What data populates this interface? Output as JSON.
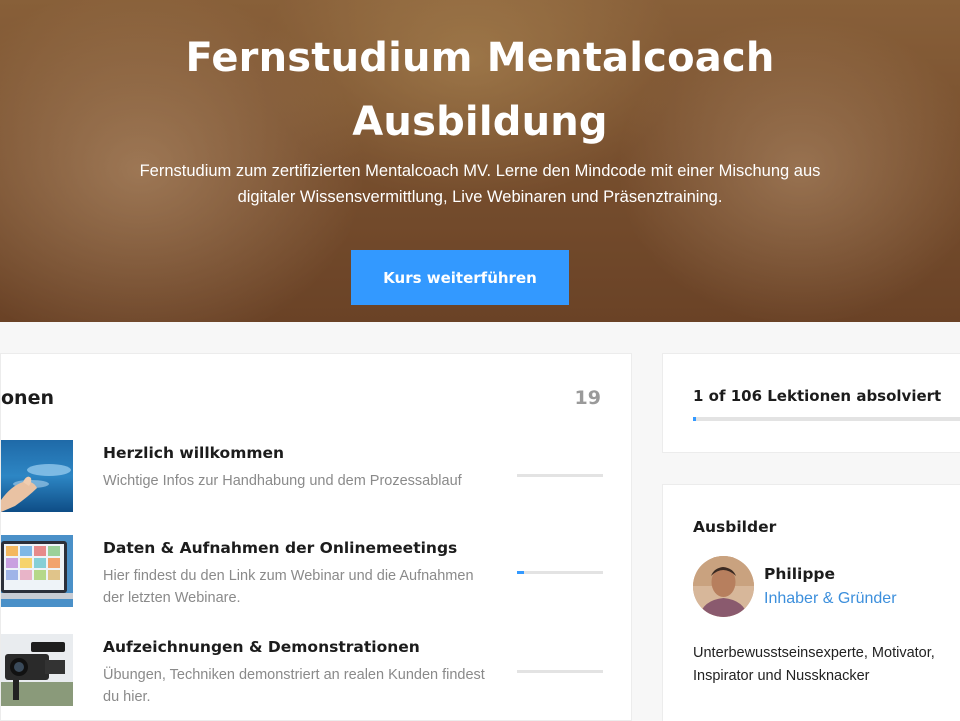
{
  "hero": {
    "title_line1": "Fernstudium Mentalcoach",
    "title_line2": "Ausbildung",
    "subtitle_line1": "Fernstudium zum zertifizierten Mentalcoach MV. Lerne den Mindcode mit einer Mischung aus",
    "subtitle_line2": "digitaler Wissensvermittlung, Live Webinaren und Präsenztraining.",
    "button_label": "Kurs weiterführen"
  },
  "lessons_panel": {
    "title": "onen",
    "count": "19",
    "items": [
      {
        "name": "Herzlich willkommen",
        "description": "Wichtige Infos zur Handhabung und dem Prozessablauf",
        "progress": 0
      },
      {
        "name": "Daten & Aufnahmen der Onlinemeetings",
        "description": "Hier findest du den Link zum Webinar und die Aufnahmen der letzten Webinare.",
        "progress": 0.08
      },
      {
        "name": "Aufzeichnungen & Demonstrationen",
        "description": "Übungen, Techniken demonstriert an realen Kunden findest du hier.",
        "progress": 0
      }
    ]
  },
  "course_progress": {
    "text": "1 of 106 Lektionen absolviert",
    "completed": 1,
    "total": 106
  },
  "instructor": {
    "heading": "Ausbilder",
    "name": "Philippe",
    "role": "Inhaber & Gründer",
    "bio": "Unterbewusstseinsexperte, Motivator, Inspirator und Nussknacker"
  },
  "colors": {
    "accent": "#3399ff",
    "link": "#3c8fdc"
  }
}
